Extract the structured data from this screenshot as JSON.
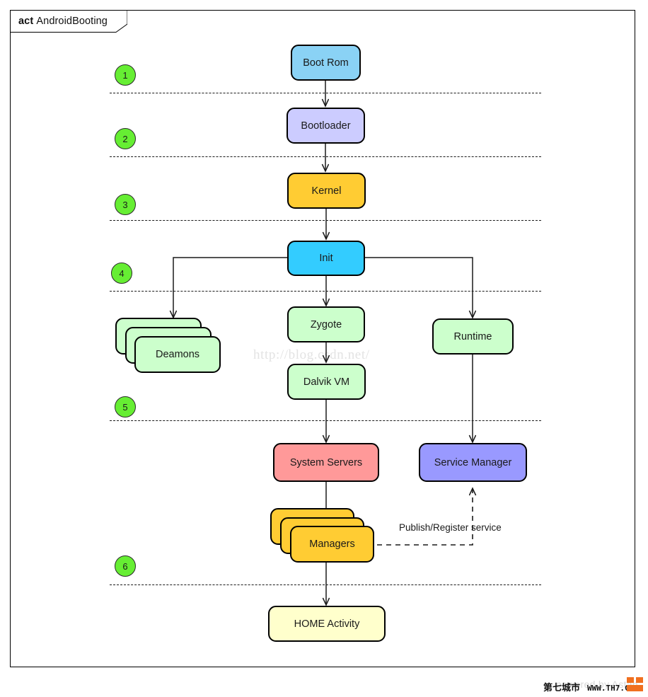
{
  "frame": {
    "kind": "act",
    "title": "AndroidBooting"
  },
  "colors": {
    "boot_rom": "#8ad2f5",
    "bootloader": "#ccccff",
    "kernel": "#ffcc33",
    "init": "#33ccff",
    "green": "#ccffcc",
    "system_servers": "#ff9999",
    "service_manager": "#9999ff",
    "managers": "#ffcc33",
    "home_activity": "#ffffcc",
    "marker": "#66ee33",
    "border": "#000000",
    "watermark": "#e3e3e3"
  },
  "markers": [
    {
      "label": "1"
    },
    {
      "label": "2"
    },
    {
      "label": "3"
    },
    {
      "label": "4"
    },
    {
      "label": "5"
    },
    {
      "label": "6"
    }
  ],
  "nodes": {
    "boot_rom": "Boot Rom",
    "bootloader": "Bootloader",
    "kernel": "Kernel",
    "init": "Init",
    "deamons": "Deamons",
    "zygote": "Zygote",
    "runtime": "Runtime",
    "dalvik_vm": "Dalvik VM",
    "system_servers": "System Servers",
    "service_manager": "Service Manager",
    "managers": "Managers",
    "home_activity": "HOME Activity"
  },
  "edges": {
    "publish_register": "Publish/Register service"
  },
  "watermarks": {
    "url": "http://blog.csdn.net/",
    "astah": "powered by Astah",
    "logo_cn": "第七城市",
    "logo_url": "WWW.TH7.CN"
  }
}
